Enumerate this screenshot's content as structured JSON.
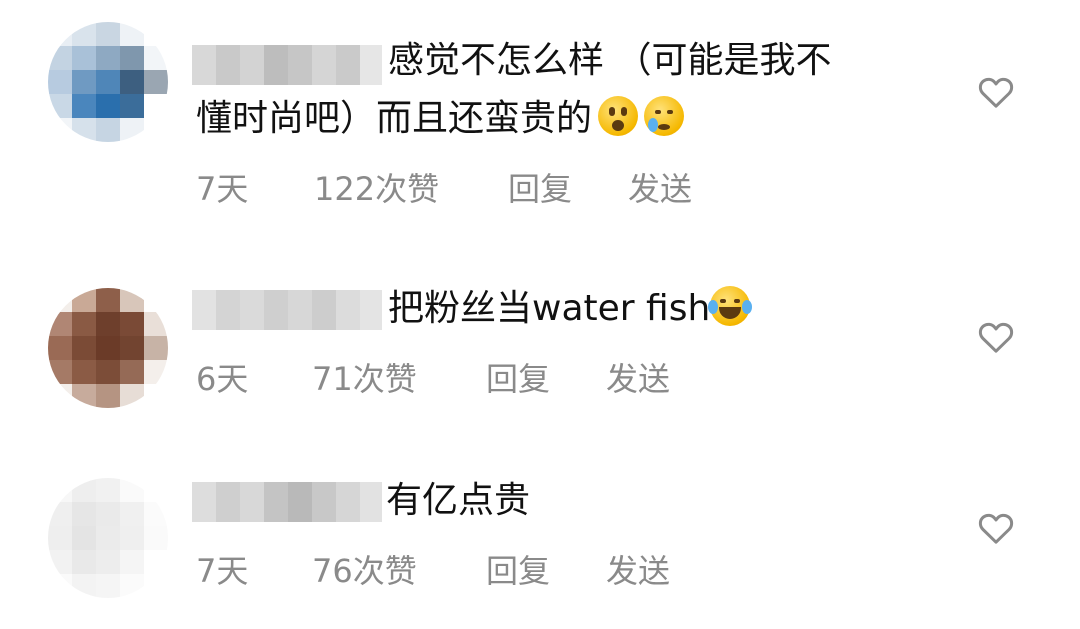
{
  "comments": [
    {
      "text_line1": "感觉不怎么样 （可能是我不",
      "text_line2": "懂时尚吧）而且还蛮贵的",
      "time": "7天",
      "likes": "122次赞",
      "reply": "回复",
      "send": "发送"
    },
    {
      "text_line1": "把粉丝当water fish",
      "time": "6天",
      "likes": "71次赞",
      "reply": "回复",
      "send": "发送"
    },
    {
      "text_line1": "有亿点贵",
      "time": "7天",
      "likes": "76次赞",
      "reply": "回复",
      "send": "发送"
    }
  ],
  "icons": {
    "like": "heart-outline-icon",
    "emoji_surprised": "hushed-face-emoji",
    "emoji_crying": "crying-face-emoji",
    "emoji_laughing": "tears-of-joy-emoji"
  },
  "colors": {
    "text": "#111111",
    "meta": "#8a8a8a",
    "heart_stroke": "#8a8a8a"
  }
}
